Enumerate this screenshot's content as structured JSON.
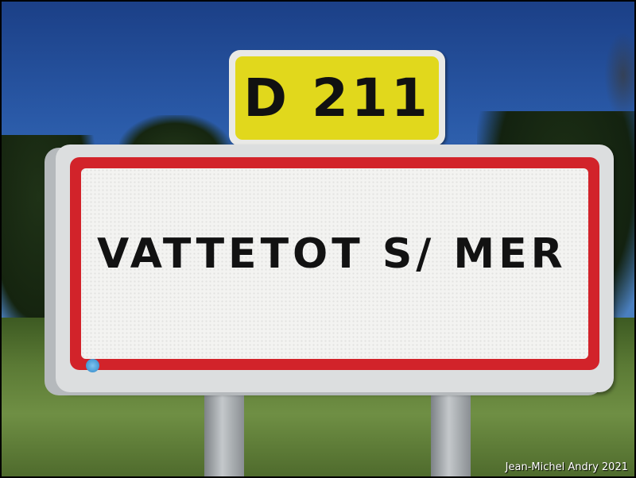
{
  "route_sign": {
    "text": "D 211",
    "color": "#e1d81c"
  },
  "town_sign": {
    "name": "VATTETOT S/ MER",
    "border_color": "#d2232a"
  },
  "watermark": {
    "text": "Jean-Michel Andry 2021"
  }
}
